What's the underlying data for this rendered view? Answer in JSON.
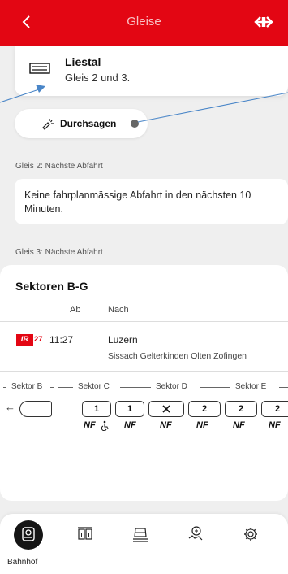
{
  "header": {
    "title": "Gleise",
    "back_icon": "chevron-left-icon",
    "logo_icon": "sbb-logo-icon",
    "brand_color": "#e30613"
  },
  "station": {
    "name": "Liestal",
    "platforms": "Gleis 2 und 3.",
    "icon": "platform-icon"
  },
  "announcements": {
    "label": "Durchsagen",
    "icon": "megaphone-icon"
  },
  "gleis2": {
    "label": "Gleis 2: Nächste Abfahrt",
    "message": "Keine fahrplanmässige Abfahrt in den nächsten 10 Minuten."
  },
  "gleis3": {
    "label": "Gleis 3: Nächste Abfahrt",
    "title": "Sektoren B-G",
    "col_ab": "Ab",
    "col_nach": "Nach",
    "departure": {
      "train_type": "IR",
      "train_number": "27",
      "time": "11:27",
      "destination": "Luzern",
      "via": "Sissach Gelterkinden Olten Zofingen"
    },
    "sectors": [
      "Sektor B",
      "Sektor C",
      "Sektor D",
      "Sektor E"
    ],
    "direction_arrow": "←",
    "cars": [
      {
        "label": "1",
        "icon": null
      },
      {
        "label": "1",
        "icon": null
      },
      {
        "label": "",
        "icon": "restaurant-icon"
      },
      {
        "label": "2",
        "icon": null
      },
      {
        "label": "2",
        "icon": null
      },
      {
        "label": "2",
        "icon": null
      }
    ],
    "nf_labels": [
      "NF",
      "NF",
      "NF",
      "NF",
      "NF",
      "NF"
    ]
  },
  "nav": {
    "items": [
      {
        "label": "Bahnhof",
        "icon": "station-icon",
        "active": true
      },
      {
        "label": "",
        "icon": "platforms-icon",
        "active": false
      },
      {
        "label": "",
        "icon": "train-icon",
        "active": false
      },
      {
        "label": "",
        "icon": "location-icon",
        "active": false
      },
      {
        "label": "",
        "icon": "settings-icon",
        "active": false
      }
    ]
  }
}
